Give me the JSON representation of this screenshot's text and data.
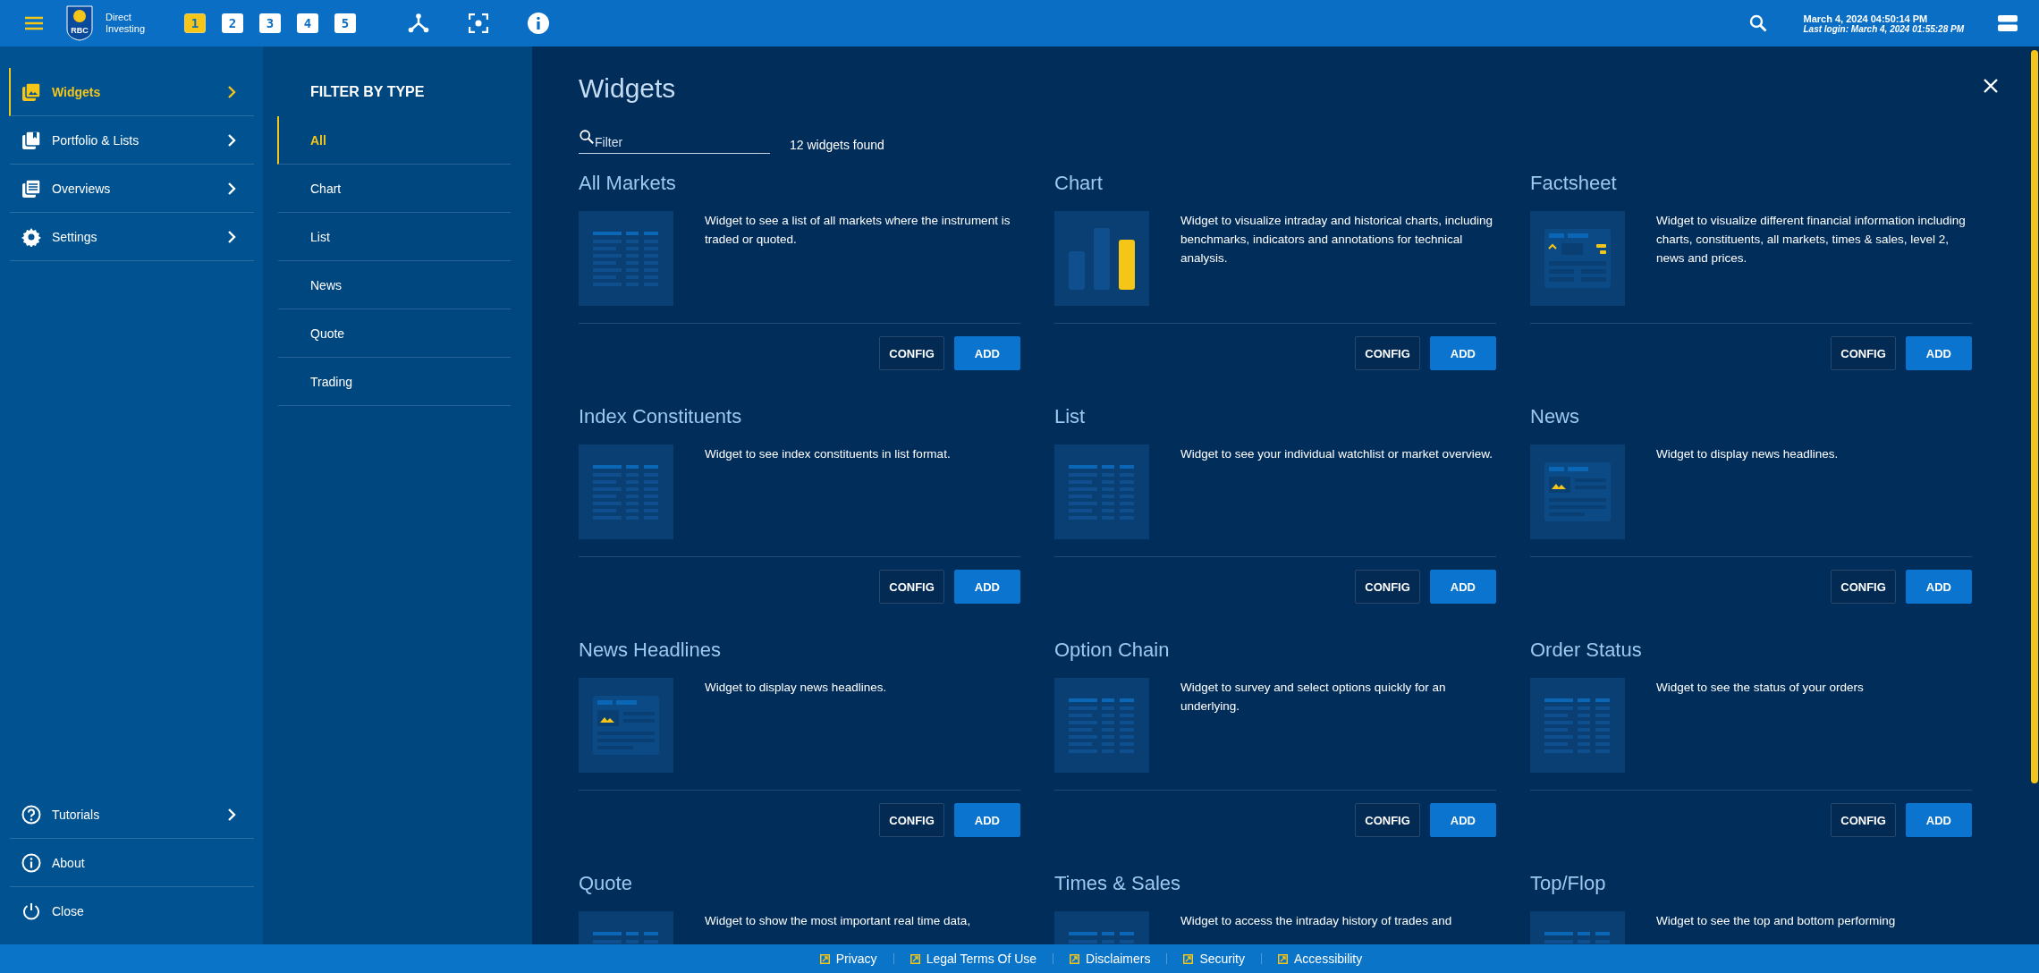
{
  "top_bar": {
    "logo_text": "RBC",
    "brand": [
      "Direct",
      "Investing"
    ],
    "workspaces": [
      {
        "label": "1",
        "selected": true
      },
      {
        "label": "2",
        "selected": false
      },
      {
        "label": "3",
        "selected": false
      },
      {
        "label": "4",
        "selected": false
      },
      {
        "label": "5",
        "selected": false
      }
    ],
    "datetime": "March 4, 2024 04:50:14 PM",
    "last_login": "Last login: March 4, 2024 01:55:28 PM"
  },
  "sidebar": {
    "items": [
      {
        "label": "Widgets",
        "selected": true
      },
      {
        "label": "Portfolio & Lists",
        "selected": false
      },
      {
        "label": "Overviews",
        "selected": false
      },
      {
        "label": "Settings",
        "selected": false
      }
    ],
    "bottom_items": [
      {
        "label": "Tutorials",
        "chevron": true
      },
      {
        "label": "About",
        "chevron": false
      },
      {
        "label": "Close",
        "chevron": false
      }
    ]
  },
  "filter_panel": {
    "heading": "FILTER BY TYPE",
    "items": [
      {
        "label": "All",
        "selected": true
      },
      {
        "label": "Chart",
        "selected": false
      },
      {
        "label": "List",
        "selected": false
      },
      {
        "label": "News",
        "selected": false
      },
      {
        "label": "Quote",
        "selected": false
      },
      {
        "label": "Trading",
        "selected": false
      }
    ]
  },
  "main": {
    "title": "Widgets",
    "filter": {
      "placeholder": "Filter"
    },
    "count": "12 widgets found",
    "widgets": [
      {
        "title": "All Markets",
        "kind": "table",
        "description": "Widget to see a list of all markets where the instrument is traded or quoted.",
        "buttons": [
          "CONFIG",
          "ADD"
        ]
      },
      {
        "title": "Chart",
        "kind": "chart",
        "description": "Widget to visualize intraday and historical charts, including benchmarks, indicators and annotations for technical analysis.",
        "buttons": [
          "CONFIG",
          "ADD"
        ]
      },
      {
        "title": "Factsheet",
        "kind": "factsheet",
        "description": "Widget to visualize different financial information including charts, constituents, all markets, times & sales, level 2, news and prices.",
        "buttons": [
          "CONFIG",
          "ADD"
        ]
      },
      {
        "title": "Index Constituents",
        "kind": "table",
        "description": "Widget to see index constituents in list format.",
        "buttons": [
          "CONFIG",
          "ADD"
        ]
      },
      {
        "title": "List",
        "kind": "table",
        "description": "Widget to see your individual watchlist or market overview.",
        "buttons": [
          "CONFIG",
          "ADD"
        ]
      },
      {
        "title": "News",
        "kind": "news",
        "description": "Widget to display news headlines.",
        "buttons": [
          "CONFIG",
          "ADD"
        ]
      },
      {
        "title": "News Headlines",
        "kind": "news",
        "description": "Widget to display news headlines.",
        "buttons": [
          "CONFIG",
          "ADD"
        ]
      },
      {
        "title": "Option Chain",
        "kind": "table",
        "description": "Widget to survey and select options quickly for an underlying.",
        "buttons": [
          "CONFIG",
          "ADD"
        ]
      },
      {
        "title": "Order Status",
        "kind": "table",
        "description": "Widget to see the status of your orders",
        "buttons": [
          "CONFIG",
          "ADD"
        ]
      },
      {
        "title": "Quote",
        "kind": "table",
        "description": "Widget to show the most important real time data,"
      },
      {
        "title": "Times & Sales",
        "kind": "table",
        "description": "Widget to access the intraday history of trades and"
      },
      {
        "title": "Top/Flop",
        "kind": "table",
        "description": "Widget to see the top and bottom performing"
      }
    ]
  },
  "footer": {
    "links": [
      "Privacy",
      "Legal Terms Of Use",
      "Disclaimers",
      "Security",
      "Accessibility"
    ]
  }
}
